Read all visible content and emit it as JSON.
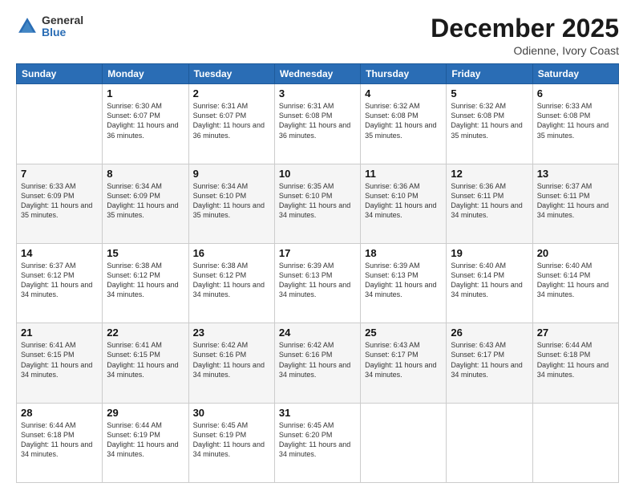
{
  "logo": {
    "general": "General",
    "blue": "Blue"
  },
  "header": {
    "title": "December 2025",
    "location": "Odienne, Ivory Coast"
  },
  "days_of_week": [
    "Sunday",
    "Monday",
    "Tuesday",
    "Wednesday",
    "Thursday",
    "Friday",
    "Saturday"
  ],
  "weeks": [
    [
      {
        "day": "",
        "info": ""
      },
      {
        "day": "1",
        "sunrise": "Sunrise: 6:30 AM",
        "sunset": "Sunset: 6:07 PM",
        "daylight": "Daylight: 11 hours and 36 minutes."
      },
      {
        "day": "2",
        "sunrise": "Sunrise: 6:31 AM",
        "sunset": "Sunset: 6:07 PM",
        "daylight": "Daylight: 11 hours and 36 minutes."
      },
      {
        "day": "3",
        "sunrise": "Sunrise: 6:31 AM",
        "sunset": "Sunset: 6:08 PM",
        "daylight": "Daylight: 11 hours and 36 minutes."
      },
      {
        "day": "4",
        "sunrise": "Sunrise: 6:32 AM",
        "sunset": "Sunset: 6:08 PM",
        "daylight": "Daylight: 11 hours and 35 minutes."
      },
      {
        "day": "5",
        "sunrise": "Sunrise: 6:32 AM",
        "sunset": "Sunset: 6:08 PM",
        "daylight": "Daylight: 11 hours and 35 minutes."
      },
      {
        "day": "6",
        "sunrise": "Sunrise: 6:33 AM",
        "sunset": "Sunset: 6:08 PM",
        "daylight": "Daylight: 11 hours and 35 minutes."
      }
    ],
    [
      {
        "day": "7",
        "sunrise": "Sunrise: 6:33 AM",
        "sunset": "Sunset: 6:09 PM",
        "daylight": "Daylight: 11 hours and 35 minutes."
      },
      {
        "day": "8",
        "sunrise": "Sunrise: 6:34 AM",
        "sunset": "Sunset: 6:09 PM",
        "daylight": "Daylight: 11 hours and 35 minutes."
      },
      {
        "day": "9",
        "sunrise": "Sunrise: 6:34 AM",
        "sunset": "Sunset: 6:10 PM",
        "daylight": "Daylight: 11 hours and 35 minutes."
      },
      {
        "day": "10",
        "sunrise": "Sunrise: 6:35 AM",
        "sunset": "Sunset: 6:10 PM",
        "daylight": "Daylight: 11 hours and 34 minutes."
      },
      {
        "day": "11",
        "sunrise": "Sunrise: 6:36 AM",
        "sunset": "Sunset: 6:10 PM",
        "daylight": "Daylight: 11 hours and 34 minutes."
      },
      {
        "day": "12",
        "sunrise": "Sunrise: 6:36 AM",
        "sunset": "Sunset: 6:11 PM",
        "daylight": "Daylight: 11 hours and 34 minutes."
      },
      {
        "day": "13",
        "sunrise": "Sunrise: 6:37 AM",
        "sunset": "Sunset: 6:11 PM",
        "daylight": "Daylight: 11 hours and 34 minutes."
      }
    ],
    [
      {
        "day": "14",
        "sunrise": "Sunrise: 6:37 AM",
        "sunset": "Sunset: 6:12 PM",
        "daylight": "Daylight: 11 hours and 34 minutes."
      },
      {
        "day": "15",
        "sunrise": "Sunrise: 6:38 AM",
        "sunset": "Sunset: 6:12 PM",
        "daylight": "Daylight: 11 hours and 34 minutes."
      },
      {
        "day": "16",
        "sunrise": "Sunrise: 6:38 AM",
        "sunset": "Sunset: 6:12 PM",
        "daylight": "Daylight: 11 hours and 34 minutes."
      },
      {
        "day": "17",
        "sunrise": "Sunrise: 6:39 AM",
        "sunset": "Sunset: 6:13 PM",
        "daylight": "Daylight: 11 hours and 34 minutes."
      },
      {
        "day": "18",
        "sunrise": "Sunrise: 6:39 AM",
        "sunset": "Sunset: 6:13 PM",
        "daylight": "Daylight: 11 hours and 34 minutes."
      },
      {
        "day": "19",
        "sunrise": "Sunrise: 6:40 AM",
        "sunset": "Sunset: 6:14 PM",
        "daylight": "Daylight: 11 hours and 34 minutes."
      },
      {
        "day": "20",
        "sunrise": "Sunrise: 6:40 AM",
        "sunset": "Sunset: 6:14 PM",
        "daylight": "Daylight: 11 hours and 34 minutes."
      }
    ],
    [
      {
        "day": "21",
        "sunrise": "Sunrise: 6:41 AM",
        "sunset": "Sunset: 6:15 PM",
        "daylight": "Daylight: 11 hours and 34 minutes."
      },
      {
        "day": "22",
        "sunrise": "Sunrise: 6:41 AM",
        "sunset": "Sunset: 6:15 PM",
        "daylight": "Daylight: 11 hours and 34 minutes."
      },
      {
        "day": "23",
        "sunrise": "Sunrise: 6:42 AM",
        "sunset": "Sunset: 6:16 PM",
        "daylight": "Daylight: 11 hours and 34 minutes."
      },
      {
        "day": "24",
        "sunrise": "Sunrise: 6:42 AM",
        "sunset": "Sunset: 6:16 PM",
        "daylight": "Daylight: 11 hours and 34 minutes."
      },
      {
        "day": "25",
        "sunrise": "Sunrise: 6:43 AM",
        "sunset": "Sunset: 6:17 PM",
        "daylight": "Daylight: 11 hours and 34 minutes."
      },
      {
        "day": "26",
        "sunrise": "Sunrise: 6:43 AM",
        "sunset": "Sunset: 6:17 PM",
        "daylight": "Daylight: 11 hours and 34 minutes."
      },
      {
        "day": "27",
        "sunrise": "Sunrise: 6:44 AM",
        "sunset": "Sunset: 6:18 PM",
        "daylight": "Daylight: 11 hours and 34 minutes."
      }
    ],
    [
      {
        "day": "28",
        "sunrise": "Sunrise: 6:44 AM",
        "sunset": "Sunset: 6:18 PM",
        "daylight": "Daylight: 11 hours and 34 minutes."
      },
      {
        "day": "29",
        "sunrise": "Sunrise: 6:44 AM",
        "sunset": "Sunset: 6:19 PM",
        "daylight": "Daylight: 11 hours and 34 minutes."
      },
      {
        "day": "30",
        "sunrise": "Sunrise: 6:45 AM",
        "sunset": "Sunset: 6:19 PM",
        "daylight": "Daylight: 11 hours and 34 minutes."
      },
      {
        "day": "31",
        "sunrise": "Sunrise: 6:45 AM",
        "sunset": "Sunset: 6:20 PM",
        "daylight": "Daylight: 11 hours and 34 minutes."
      },
      {
        "day": "",
        "info": ""
      },
      {
        "day": "",
        "info": ""
      },
      {
        "day": "",
        "info": ""
      }
    ]
  ]
}
